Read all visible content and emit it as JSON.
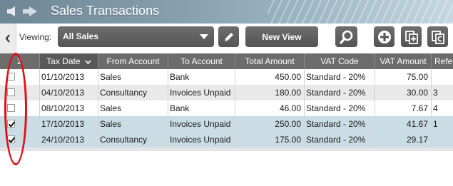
{
  "window": {
    "title": "Sales Transactions"
  },
  "toolbar": {
    "viewing_label": "Viewing:",
    "view_select_value": "All Sales",
    "new_view_label": "New View"
  },
  "table": {
    "columns": [
      "2",
      "Tax Date",
      "From Account",
      "To Account",
      "Total Amount",
      "VAT Code",
      "VAT Amount",
      "Refe"
    ],
    "rows": [
      {
        "checked": false,
        "tax_date": "01/10/2013",
        "from": "Sales",
        "to": "Bank",
        "total": "450.00",
        "vat_code": "Standard - 20%",
        "vat_amount": "75.00",
        "ref": ""
      },
      {
        "checked": false,
        "tax_date": "04/10/2013",
        "from": "Consultancy",
        "to": "Invoices Unpaid",
        "total": "180.00",
        "vat_code": "Standard - 20%",
        "vat_amount": "30.00",
        "ref": "3"
      },
      {
        "checked": false,
        "tax_date": "08/10/2013",
        "from": "Sales",
        "to": "Bank",
        "total": "46.00",
        "vat_code": "Standard - 20%",
        "vat_amount": "7.67",
        "ref": "4"
      },
      {
        "checked": true,
        "tax_date": "17/10/2013",
        "from": "Sales",
        "to": "Invoices Unpaid",
        "total": "250.00",
        "vat_code": "Standard - 20%",
        "vat_amount": "41.67",
        "ref": "1"
      },
      {
        "checked": true,
        "tax_date": "24/10/2013",
        "from": "Consultancy",
        "to": "Invoices Unpaid",
        "total": "175.00",
        "vat_code": "Standard - 20%",
        "vat_amount": "29.17",
        "ref": ""
      }
    ]
  },
  "icons": {
    "back": "arrow-left-icon",
    "forward": "arrow-right-icon",
    "collapse": "chevron-left-icon",
    "edit": "pencil-icon",
    "search": "magnifier-icon",
    "add": "plus-circle-icon",
    "copy": "copy-icon",
    "copy_c": "copy-c-icon"
  },
  "colors": {
    "annotation": "#e0101a",
    "checked_row": "#cbdde4",
    "header": "#6c6c6c"
  }
}
